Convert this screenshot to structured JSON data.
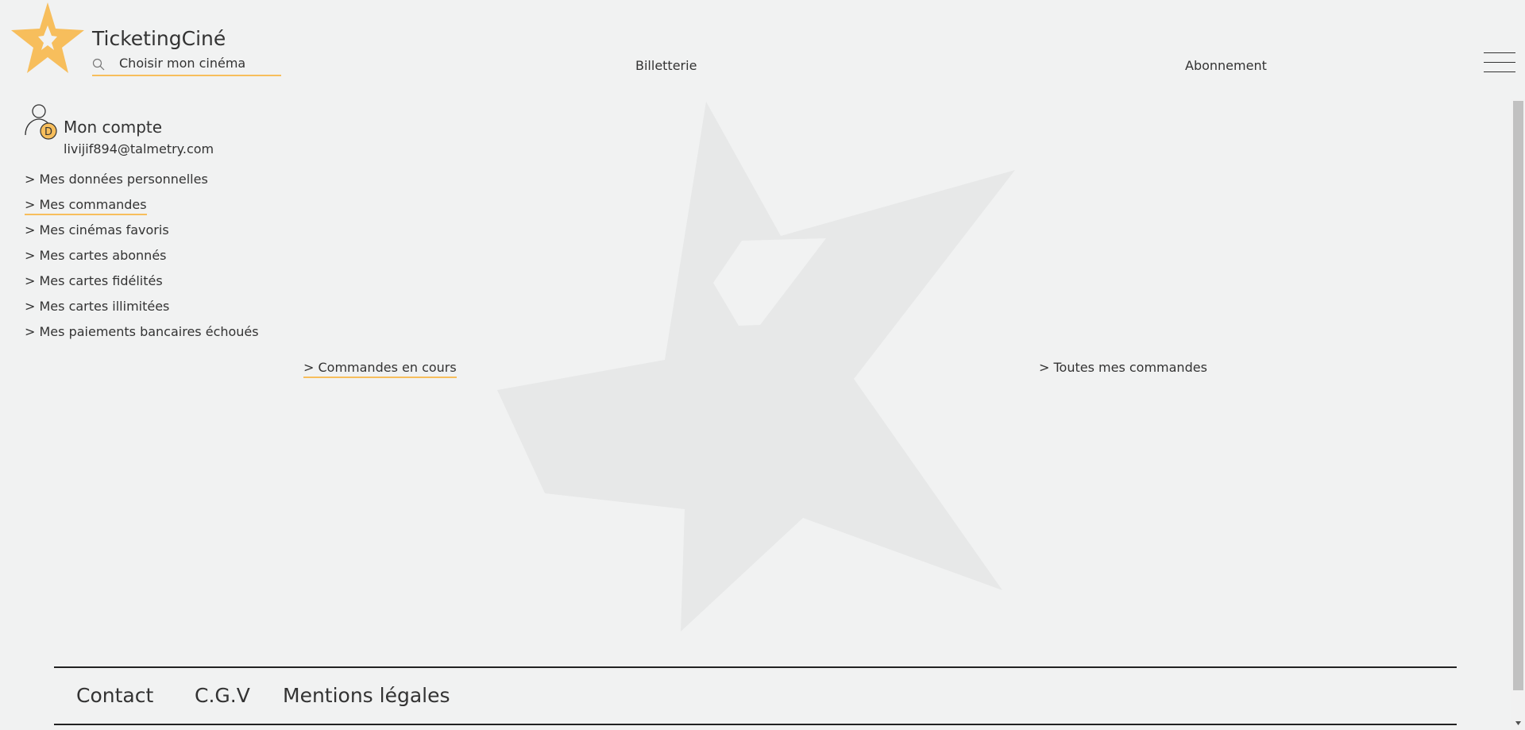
{
  "brand": {
    "name": "TicketingCiné",
    "accent_color": "#f7be5c"
  },
  "search": {
    "value": "Choisir mon cinéma",
    "icon": "search-icon"
  },
  "nav": {
    "billetterie": "Billetterie",
    "abonnement": "Abonnement",
    "menu_icon": "hamburger-menu-icon"
  },
  "account": {
    "title": "Mon compte",
    "email": "livijif894@talmetry.com",
    "avatar_initial": "D",
    "menu": [
      {
        "label": "> Mes données personnelles",
        "active": false
      },
      {
        "label": "> Mes commandes",
        "active": true
      },
      {
        "label": "> Mes cinémas favoris",
        "active": false
      },
      {
        "label": "> Mes cartes abonnés",
        "active": false
      },
      {
        "label": "> Mes cartes fidélités",
        "active": false
      },
      {
        "label": "> Mes cartes illimitées",
        "active": false
      },
      {
        "label": "> Mes paiements bancaires échoués",
        "active": false
      }
    ]
  },
  "orders": {
    "tabs": [
      {
        "label": "> Commandes en cours",
        "active": true
      },
      {
        "label": "> Toutes mes commandes",
        "active": false
      }
    ]
  },
  "footer": {
    "contact": "Contact",
    "cgv": "C.G.V",
    "mentions": "Mentions légales"
  }
}
